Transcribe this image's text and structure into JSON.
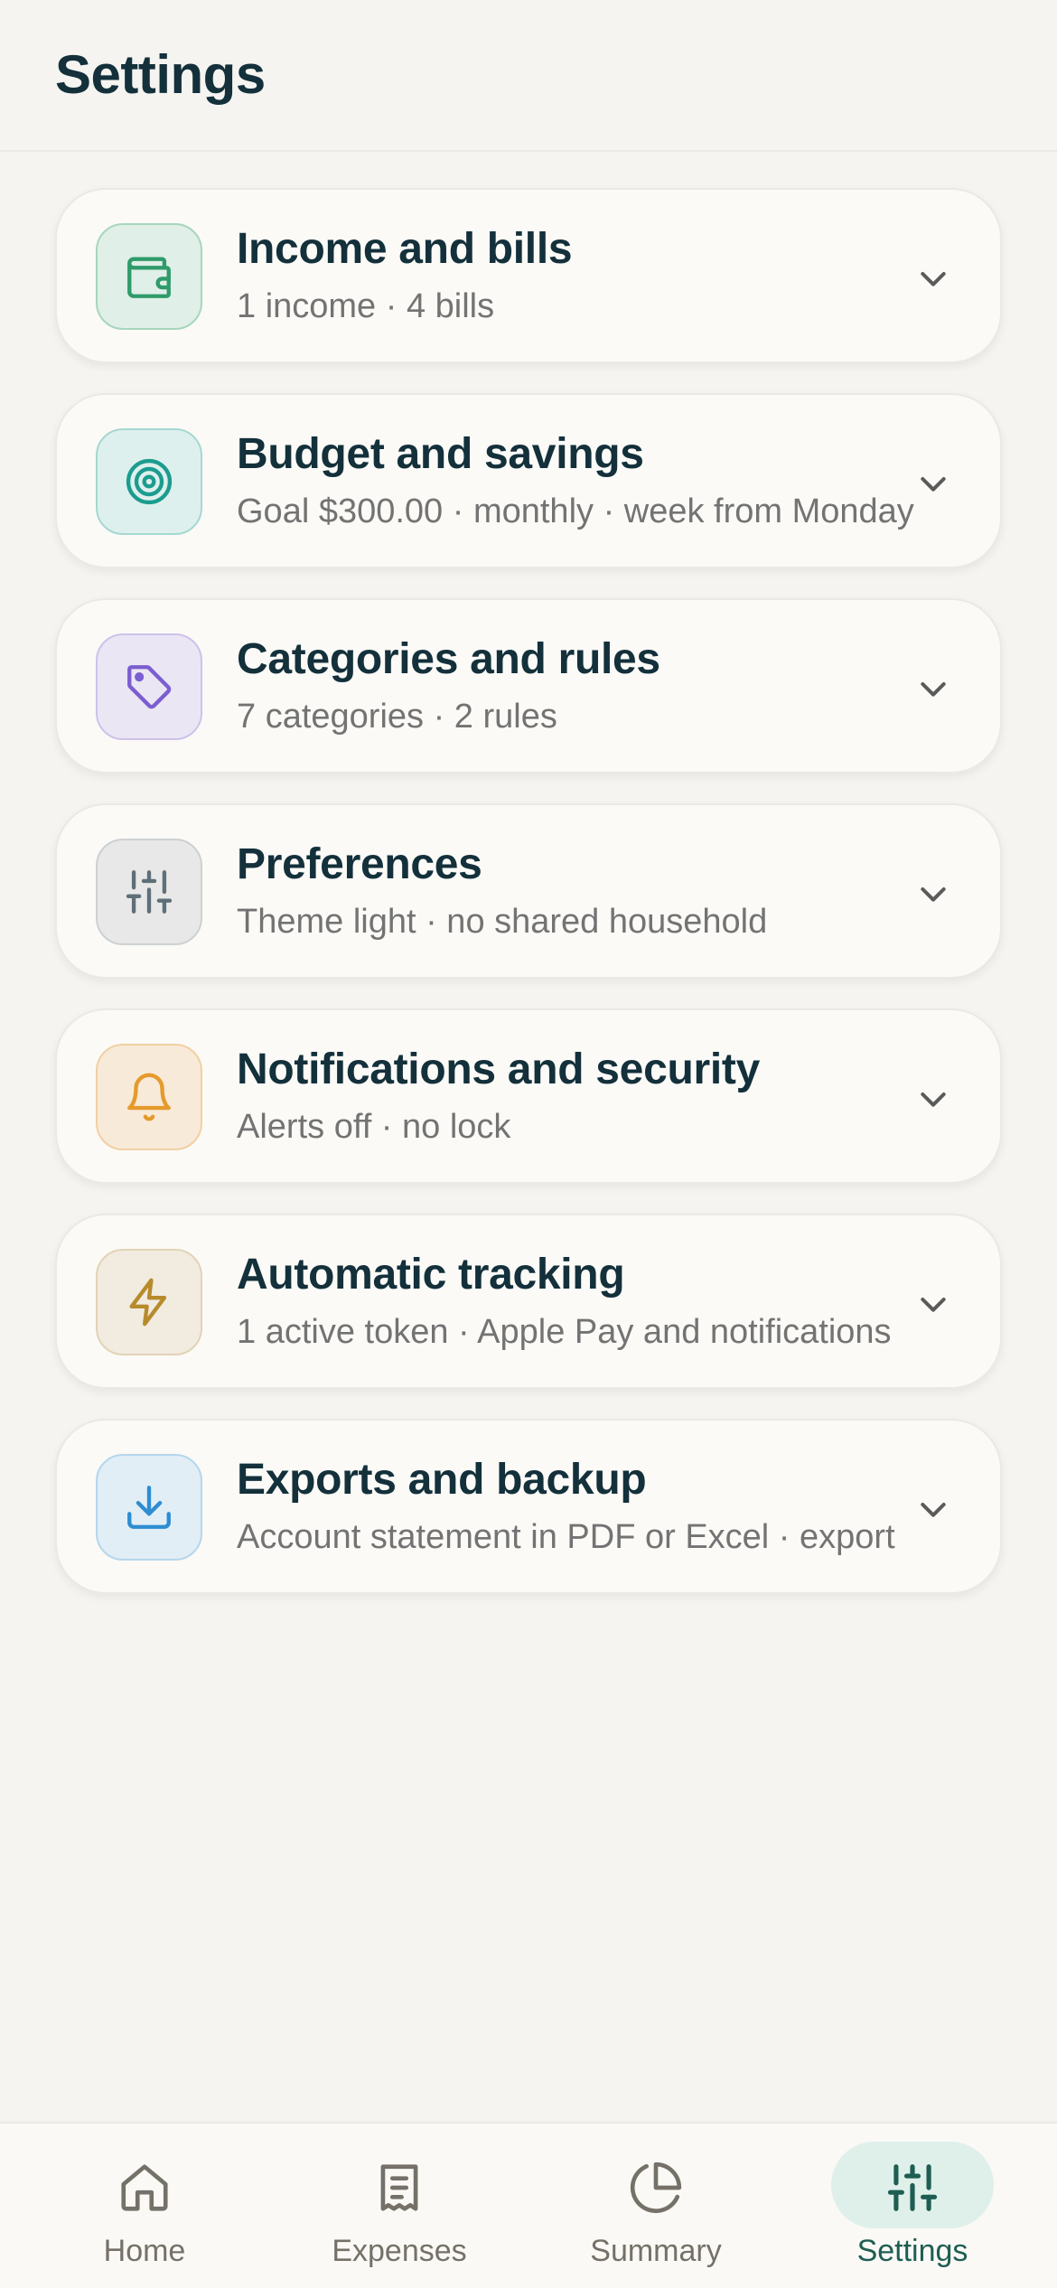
{
  "header": {
    "title": "Settings"
  },
  "sections": [
    {
      "title": "Income and bills",
      "subtitle": "1 income · 4 bills",
      "icon": "wallet-icon",
      "color": "#2f9b6b",
      "bg": "#e0efe7",
      "border": "#a7d6bd"
    },
    {
      "title": "Budget and savings",
      "subtitle": "Goal $300.00 · monthly · week from Monday",
      "icon": "target-icon",
      "color": "#1c9c8f",
      "bg": "#def0ed",
      "border": "#a5d8d1"
    },
    {
      "title": "Categories and rules",
      "subtitle": "7 categories · 2 rules",
      "icon": "tag-icon",
      "color": "#7b5ed0",
      "bg": "#ebe6f4",
      "border": "#cfc2ea"
    },
    {
      "title": "Preferences",
      "subtitle": "Theme light · no shared household",
      "icon": "sliders-icon",
      "color": "#5f6f7a",
      "bg": "#e7e8e7",
      "border": "#cdd1d2"
    },
    {
      "title": "Notifications and security",
      "subtitle": "Alerts off · no lock",
      "icon": "bell-icon",
      "color": "#e59a2c",
      "bg": "#f8ead9",
      "border": "#f0d0a2"
    },
    {
      "title": "Automatic tracking",
      "subtitle": "1 active token · Apple Pay and notifications",
      "icon": "lightning-icon",
      "color": "#b78b2c",
      "bg": "#f1ebe0",
      "border": "#e1d4b5"
    },
    {
      "title": "Exports and backup",
      "subtitle": "Account statement in PDF or Excel · export",
      "icon": "download-icon",
      "color": "#2e8dd1",
      "bg": "#e1eef6",
      "border": "#b5d6ec"
    }
  ],
  "tabbar": {
    "tabs": [
      {
        "label": "Home",
        "icon": "home-icon"
      },
      {
        "label": "Expenses",
        "icon": "receipt-icon"
      },
      {
        "label": "Summary",
        "icon": "pie-chart-icon"
      },
      {
        "label": "Settings",
        "icon": "sliders-icon",
        "active": true
      }
    ]
  }
}
